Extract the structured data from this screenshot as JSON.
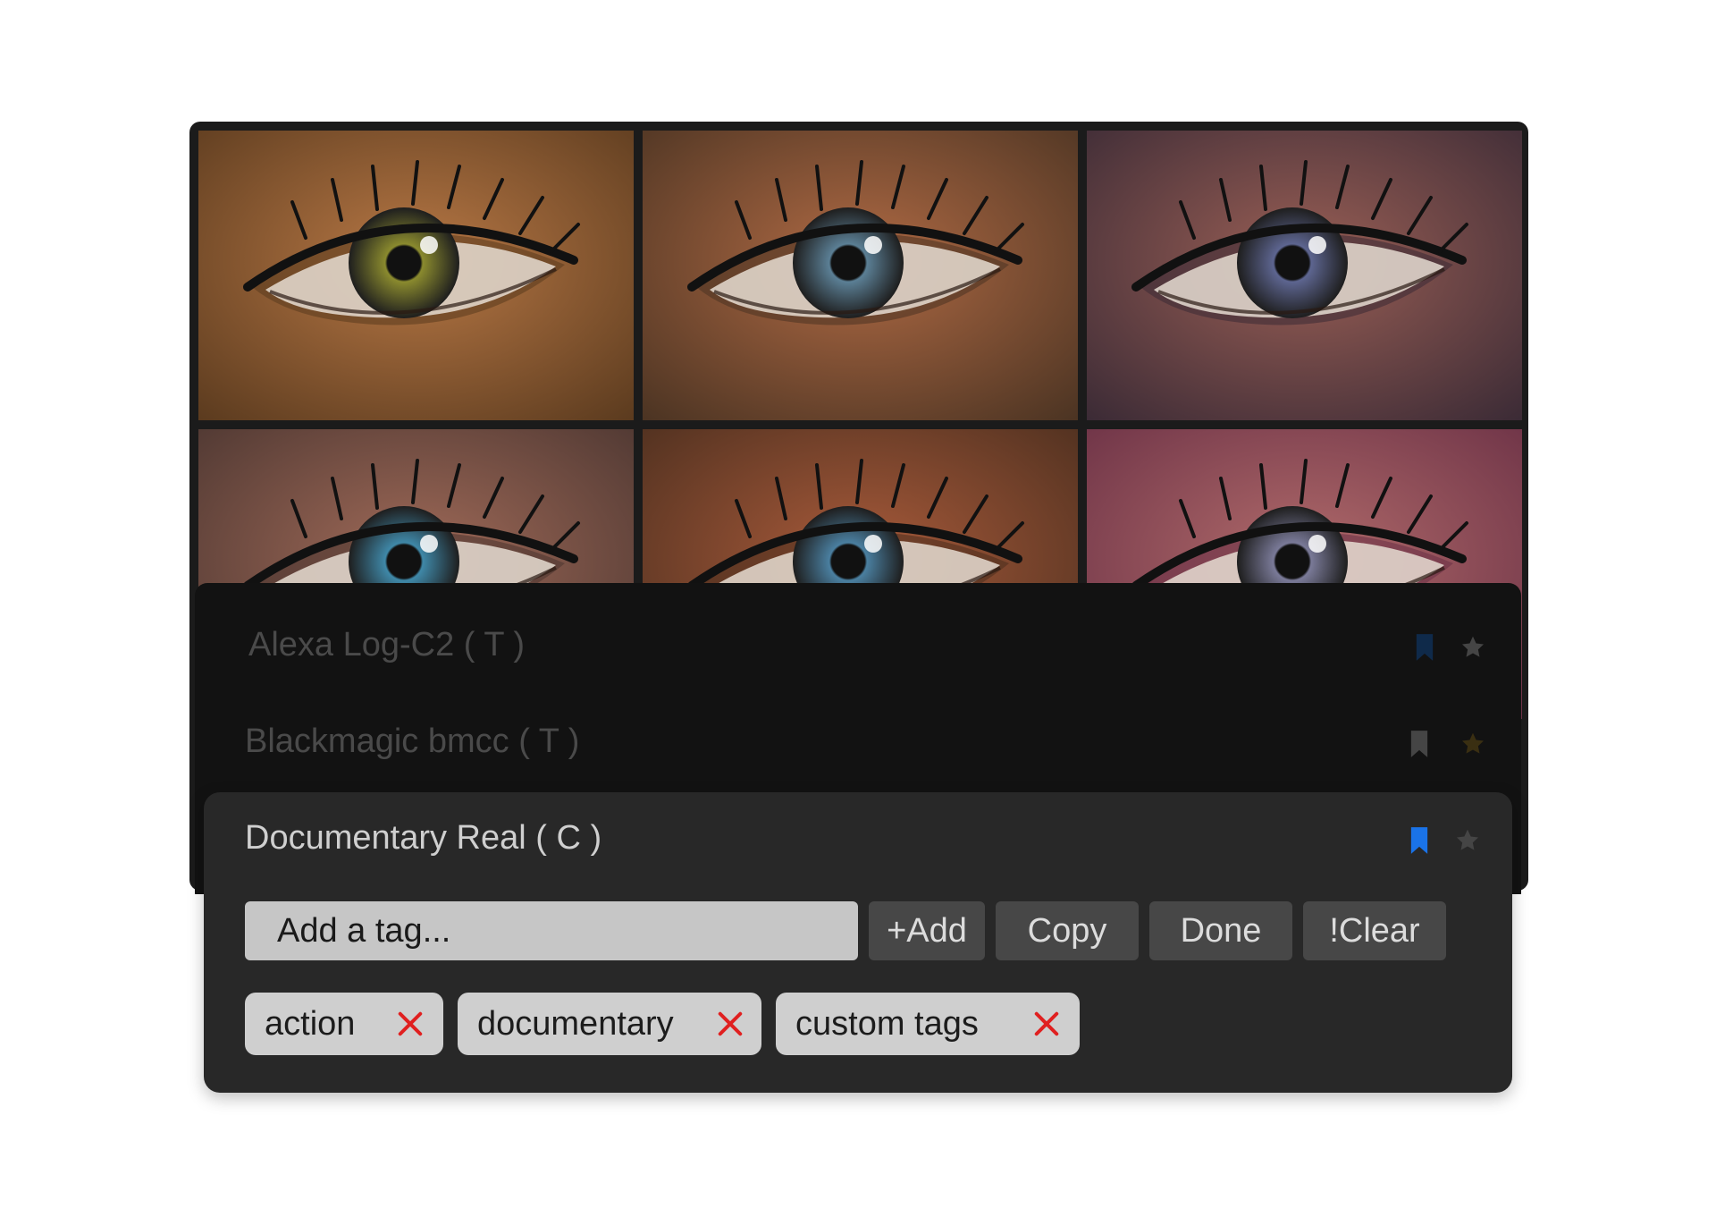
{
  "colors": {
    "accent_blue": "#1a73e8",
    "dim_blue": "#0f2a4a",
    "dim_gold": "#3a2f12",
    "icon_gray": "#454545",
    "remove_red": "#e02020"
  },
  "gallery": {
    "tiles": [
      {
        "iris": "#8a8a2e",
        "skin": "#b87845",
        "shadow": "#5a3a1e"
      },
      {
        "iris": "#5b7f95",
        "skin": "#b06a44",
        "shadow": "#4a3322"
      },
      {
        "iris": "#5d6590",
        "skin": "#9a5f55",
        "shadow": "#3a2a35"
      },
      {
        "iris": "#3f88a8",
        "skin": "#a06a58",
        "shadow": "#4a3530"
      },
      {
        "iris": "#4a7fa0",
        "skin": "#a85a3a",
        "shadow": "#4a2e1e"
      },
      {
        "iris": "#7a7a98",
        "skin": "#b06a6a",
        "shadow": "#6a3045"
      }
    ]
  },
  "list": {
    "items": [
      {
        "title": "Alexa Log-C2 ( T )",
        "bookmark_icon": "bookmark-icon",
        "star_icon": "star-icon"
      },
      {
        "title": "Blackmagic bmcc ( T )",
        "bookmark_icon": "bookmark-icon",
        "star_icon": "star-icon"
      }
    ]
  },
  "selected": {
    "title": "Documentary Real ( C )",
    "bookmark_icon": "bookmark-icon",
    "star_icon": "star-icon",
    "tag_input": {
      "placeholder": "Add a tag...",
      "value": ""
    },
    "buttons": {
      "add": "+Add",
      "copy": "Copy",
      "done": "Done",
      "clear": "!Clear"
    },
    "tags": [
      {
        "label": "action",
        "remove_icon": "close-icon"
      },
      {
        "label": "documentary",
        "remove_icon": "close-icon"
      },
      {
        "label": "custom tags",
        "remove_icon": "close-icon"
      }
    ]
  }
}
